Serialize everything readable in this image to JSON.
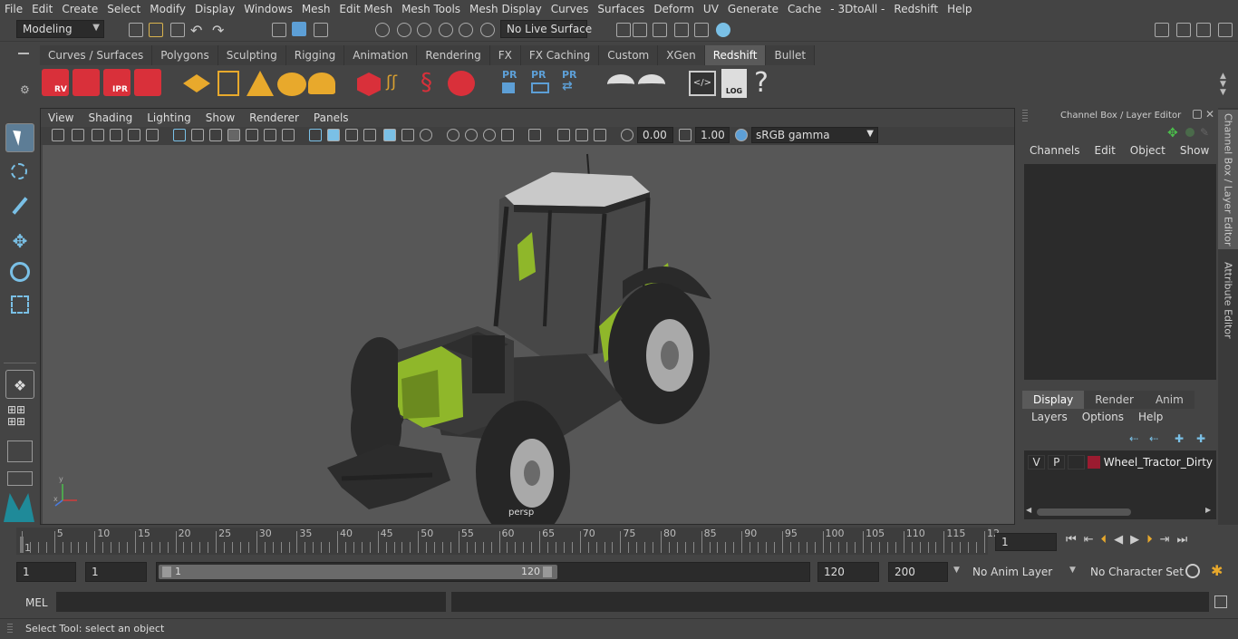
{
  "menu": [
    "File",
    "Edit",
    "Create",
    "Select",
    "Modify",
    "Display",
    "Windows",
    "Mesh",
    "Edit Mesh",
    "Mesh Tools",
    "Mesh Display",
    "Curves",
    "Surfaces",
    "Deform",
    "UV",
    "Generate",
    "Cache",
    "- 3DtoAll -",
    "Redshift",
    "Help"
  ],
  "status": {
    "mode": "Modeling",
    "live_surface": "No Live Surface"
  },
  "shelf_tabs": [
    "Curves / Surfaces",
    "Polygons",
    "Sculpting",
    "Rigging",
    "Animation",
    "Rendering",
    "FX",
    "FX Caching",
    "Custom",
    "XGen",
    "Redshift",
    "Bullet"
  ],
  "shelf_active": "Redshift",
  "shelf_labels": {
    "rv": "RV",
    "ipr": "IPR",
    "pr": "PR",
    "log": "LOG",
    "help": "?"
  },
  "viewport": {
    "menu": [
      "View",
      "Shading",
      "Lighting",
      "Show",
      "Renderer",
      "Panels"
    ],
    "exposure": "0.00",
    "gamma": "1.00",
    "color_space": "sRGB gamma",
    "camera_label": "persp"
  },
  "channel_box": {
    "title": "Channel Box / Layer Editor",
    "menu": [
      "Channels",
      "Edit",
      "Object",
      "Show"
    ],
    "layer_tabs": [
      "Display",
      "Render",
      "Anim"
    ],
    "layer_menu": [
      "Layers",
      "Options",
      "Help"
    ],
    "layer": {
      "v": "V",
      "p": "P",
      "name": "Wheel_Tractor_Dirty",
      "color": "#9b1b30"
    }
  },
  "side_tabs": [
    "Channel Box / Layer Editor",
    "Attribute Editor"
  ],
  "timeline": {
    "ticks": [
      "1",
      "5",
      "10",
      "15",
      "20",
      "25",
      "30",
      "35",
      "40",
      "45",
      "50",
      "55",
      "60",
      "65",
      "70",
      "75",
      "80",
      "85",
      "90",
      "95",
      "100",
      "105",
      "110",
      "115",
      "12"
    ],
    "current_frame": "1"
  },
  "range": {
    "start": "1",
    "playback_start": "1",
    "range_start": "1",
    "range_end": "120",
    "playback_end": "120",
    "end": "200",
    "anim_layer": "No Anim Layer",
    "char_set": "No Character Set"
  },
  "mel": {
    "label": "MEL"
  },
  "help_text": "Select Tool: select an object",
  "colors": {
    "accent": "#5d9fd6",
    "tractor_green": "#8fb72a",
    "layer_red": "#9b1b30"
  }
}
